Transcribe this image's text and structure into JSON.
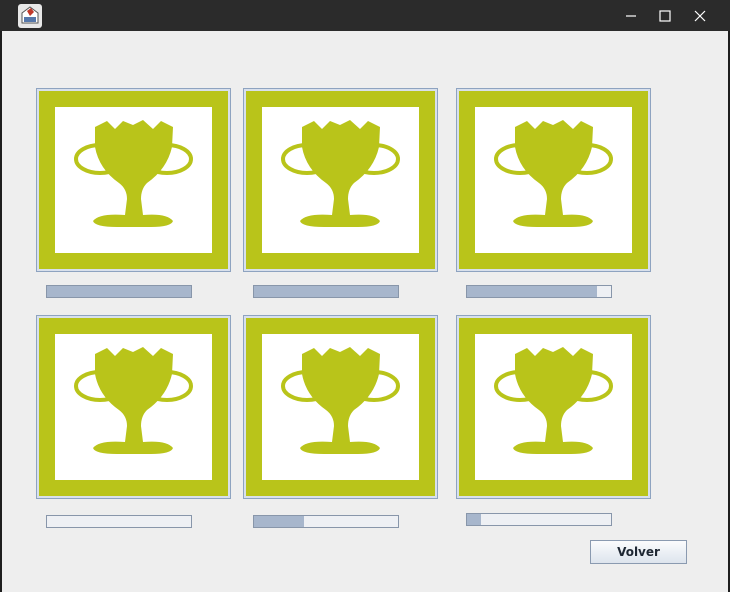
{
  "titlebar": {
    "app_icon": "java-cup-icon",
    "minimize_icon": "minimize-icon",
    "maximize_icon": "maximize-icon",
    "close_icon": "close-icon"
  },
  "colors": {
    "trophy": "#b9c41a",
    "progress_fill": "#a7b6cc",
    "window_bg": "#eeeeee",
    "titlebar_bg": "#2b2b2b"
  },
  "achievements": [
    {
      "icon": "trophy-icon",
      "progress": 1.0
    },
    {
      "icon": "trophy-icon",
      "progress": 1.0
    },
    {
      "icon": "trophy-icon",
      "progress": 0.9
    },
    {
      "icon": "trophy-icon",
      "progress": 0.0
    },
    {
      "icon": "trophy-icon",
      "progress": 0.35
    },
    {
      "icon": "trophy-icon",
      "progress": 0.1
    }
  ],
  "footer": {
    "back_label": "Volver"
  }
}
